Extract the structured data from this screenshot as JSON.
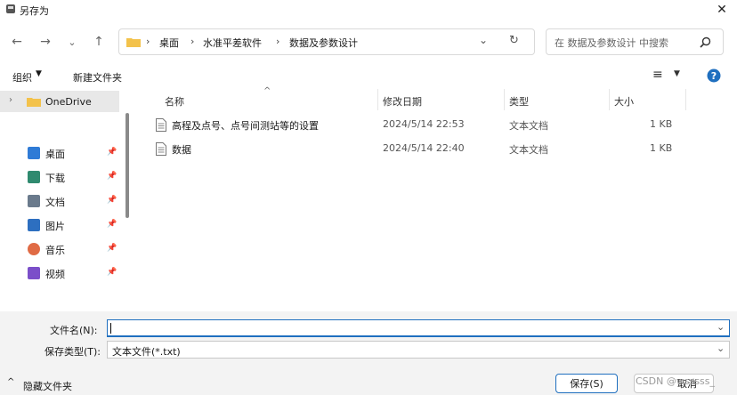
{
  "window": {
    "title": "另存为"
  },
  "address_bar": {
    "crumbs": [
      "桌面",
      "水准平差软件",
      "数据及参数设计"
    ]
  },
  "search": {
    "placeholder": "在 数据及参数设计 中搜索"
  },
  "toolbar": {
    "organize": "组织",
    "new_folder": "新建文件夹"
  },
  "sidebar": {
    "onedrive": "OneDrive",
    "items": [
      {
        "label": "桌面",
        "icon": "desktop-icon",
        "color": "#2f7bd6"
      },
      {
        "label": "下载",
        "icon": "download-icon",
        "color": "#2f8a6f"
      },
      {
        "label": "文档",
        "icon": "document-icon",
        "color": "#6a7a8c"
      },
      {
        "label": "图片",
        "icon": "picture-icon",
        "color": "#2d6fc0"
      },
      {
        "label": "音乐",
        "icon": "music-icon",
        "color": "#e06b45"
      },
      {
        "label": "视频",
        "icon": "video-icon",
        "color": "#7b4fc9"
      }
    ]
  },
  "columns": {
    "name": "名称",
    "modified": "修改日期",
    "type": "类型",
    "size": "大小"
  },
  "files": [
    {
      "name": "高程及点号、点号间测站等的设置",
      "modified": "2024/5/14 22:53",
      "type": "文本文档",
      "size": "1 KB"
    },
    {
      "name": "数据",
      "modified": "2024/5/14 22:40",
      "type": "文本文档",
      "size": "1 KB"
    }
  ],
  "form": {
    "filename_label": "文件名(N):",
    "filename_value": "",
    "filetype_label": "保存类型(T):",
    "filetype_value": "文本文件(*.txt)"
  },
  "footer": {
    "hide_folders": "隐藏文件夹",
    "save": "保存(S)",
    "cancel": "取消",
    "watermark": "CSDN @wsssss_"
  },
  "colors": {
    "accent": "#1f6fbf",
    "folder": "#f3c24b"
  }
}
